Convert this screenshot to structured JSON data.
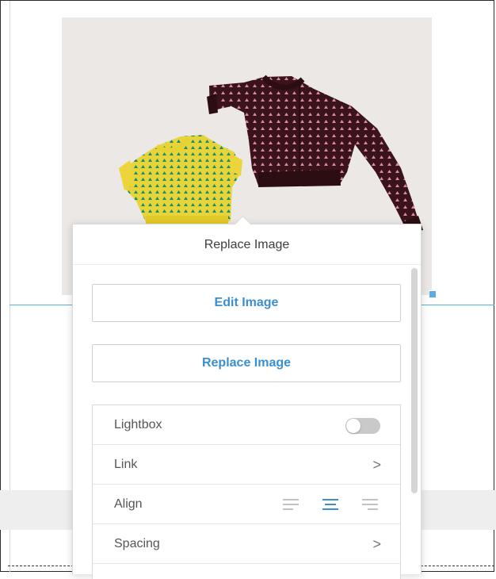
{
  "image": {
    "description_icon": "knitted-sweaters-photo-icon"
  },
  "popover": {
    "title": "Replace Image",
    "edit_button": "Edit Image",
    "replace_button": "Replace Image"
  },
  "settings": {
    "rows": [
      {
        "label": "Lightbox",
        "control": "toggle",
        "toggle_on": false
      },
      {
        "label": "Link",
        "control": "chevron",
        "chevron": ">"
      },
      {
        "label": "Align",
        "control": "align",
        "options": [
          "left",
          "center",
          "right"
        ],
        "selected": "center"
      },
      {
        "label": "Spacing",
        "control": "chevron",
        "chevron": ">"
      }
    ]
  },
  "colors": {
    "accent": "#3b8fd0",
    "selection": "#5aaee3",
    "text": "#555555",
    "band": "#eeeeee"
  }
}
